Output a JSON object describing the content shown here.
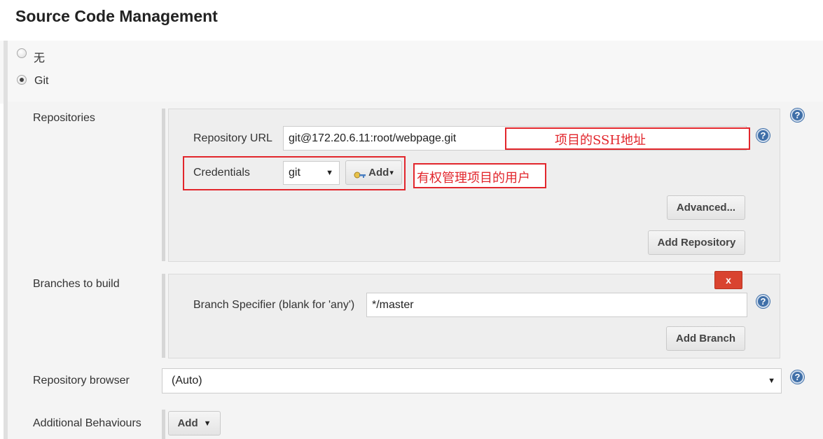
{
  "section": {
    "title": "Source Code Management"
  },
  "scm_options": [
    {
      "label": "无",
      "checked": false
    },
    {
      "label": "Git",
      "checked": true
    }
  ],
  "repositories": {
    "label": "Repositories",
    "repo_url_label": "Repository URL",
    "repo_url_value": "git@172.20.6.11:root/webpage.git",
    "credentials_label": "Credentials",
    "credentials_value": "git",
    "add_label": "Add",
    "advanced_label": "Advanced...",
    "add_repository_label": "Add Repository"
  },
  "annotations": {
    "ssh_note": "项目的SSH地址",
    "user_note": "有权管理项目的用户",
    "color": "#e2262c"
  },
  "branches": {
    "label": "Branches to build",
    "delete_label": "x",
    "specifier_label": "Branch Specifier (blank for 'any')",
    "specifier_value": "*/master",
    "add_branch_label": "Add Branch"
  },
  "repo_browser": {
    "label": "Repository browser",
    "value": "(Auto)"
  },
  "additional": {
    "label": "Additional Behaviours",
    "add_label": "Add"
  },
  "icons": {
    "help": "help-icon",
    "key": "key-icon",
    "dropdown": "chevron-down-icon"
  },
  "colors": {
    "help_blue": "#3f6fa8",
    "delete_red": "#d9432f"
  }
}
